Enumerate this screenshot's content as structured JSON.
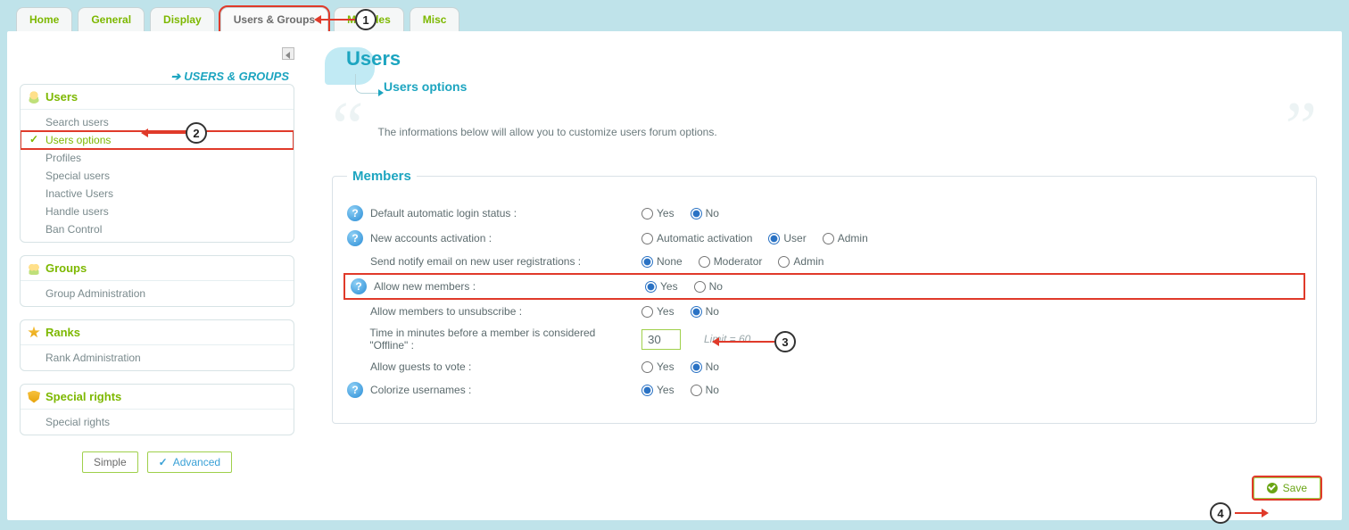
{
  "tabs": {
    "home": "Home",
    "general": "General",
    "display": "Display",
    "users_groups": "Users & Groups",
    "modules": "Modules",
    "misc": "Misc"
  },
  "breadcrumb": "USERS & GROUPS",
  "sidebar": {
    "users": {
      "title": "Users",
      "items": [
        "Search users",
        "Users options",
        "Profiles",
        "Special users",
        "Inactive Users",
        "Handle users",
        "Ban Control"
      ]
    },
    "groups": {
      "title": "Groups",
      "items": [
        "Group Administration"
      ]
    },
    "ranks": {
      "title": "Ranks",
      "items": [
        "Rank Administration"
      ]
    },
    "special": {
      "title": "Special rights",
      "items": [
        "Special rights"
      ]
    }
  },
  "mode": {
    "simple": "Simple",
    "advanced": "Advanced"
  },
  "main": {
    "title": "Users",
    "subtitle": "Users options",
    "intro": "The informations below will allow you to customize users forum options.",
    "fieldset_title": "Members",
    "rows": {
      "auto_login": {
        "label": "Default automatic login status :",
        "yes": "Yes",
        "no": "No",
        "selected": "no"
      },
      "new_acct": {
        "label": "New accounts activation :",
        "opts": [
          "Automatic activation",
          "User",
          "Admin"
        ],
        "selected": "User"
      },
      "notify": {
        "label": "Send notify email on new user registrations :",
        "opts": [
          "None",
          "Moderator",
          "Admin"
        ],
        "selected": "None"
      },
      "allow_new": {
        "label": "Allow new members :",
        "yes": "Yes",
        "no": "No",
        "selected": "yes"
      },
      "unsubscribe": {
        "label": "Allow members to unsubscribe :",
        "yes": "Yes",
        "no": "No",
        "selected": "no"
      },
      "offline": {
        "label": "Time in minutes before a member is considered \"Offline\" :",
        "value": "30",
        "limit": "Limit = 60"
      },
      "guest_vote": {
        "label": "Allow guests to vote :",
        "yes": "Yes",
        "no": "No",
        "selected": "no"
      },
      "colorize": {
        "label": "Colorize usernames :",
        "yes": "Yes",
        "no": "No",
        "selected": "yes"
      }
    },
    "save": "Save"
  },
  "callouts": {
    "c1": "1",
    "c2": "2",
    "c3": "3",
    "c4": "4"
  }
}
